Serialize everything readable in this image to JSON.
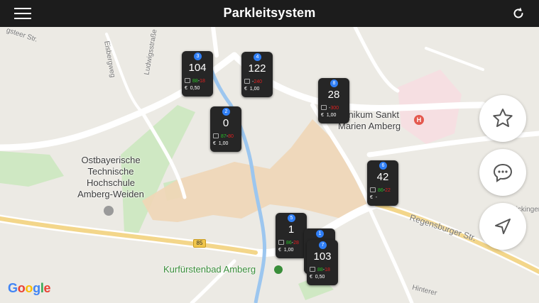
{
  "header": {
    "title": "Parkleitsystem",
    "menu_icon": "hamburger-menu-icon",
    "refresh_icon": "refresh-icon"
  },
  "map": {
    "places": {
      "university": "Ostbayerische\nTechnische\nHochschule\nAmberg-Weiden",
      "clinic": "Klinikum Sankt\nMarien Amberg",
      "pool": "Kurfürstenbad Amberg"
    },
    "streets": {
      "s1": "gsteer Str.",
      "s2": "Eisbergweg",
      "s3": "Ludwigsstraße",
      "s4": "Regensburger Str.",
      "s5": "Hinterer",
      "s6": "Sickingenring"
    },
    "road_badge": "85",
    "google_logo": [
      "G",
      "o",
      "o",
      "g",
      "l",
      "e"
    ]
  },
  "carparks": [
    {
      "id": "3",
      "free": "104",
      "green": "88",
      "red": "18",
      "price": "0,50"
    },
    {
      "id": "4",
      "free": "122",
      "green": "",
      "red": "240",
      "price": "1,00"
    },
    {
      "id": "8",
      "free": "28",
      "green": "",
      "red": "300",
      "price": "1,00"
    },
    {
      "id": "2",
      "free": "0",
      "green": "87",
      "red": "80",
      "price": "1,00"
    },
    {
      "id": "6",
      "free": "42",
      "green": "86",
      "red": "22",
      "price": "-"
    },
    {
      "id": "5",
      "free": "1",
      "green": "86",
      "red": "28",
      "price": "1,00"
    },
    {
      "id": "1",
      "free": "",
      "green": "",
      "red": "",
      "price": ""
    },
    {
      "id": "7",
      "free": "103",
      "green": "88",
      "red": "18",
      "price": "0,50"
    }
  ],
  "currency_symbol": "€",
  "fabs": {
    "favorites_icon": "star-icon",
    "messages_icon": "chat-bubble-icon",
    "locate_icon": "navigation-arrow-icon"
  },
  "colors": {
    "topbar": "#1c1c1c",
    "marker_badge": "#2f7ef5",
    "free_green": "#27c127",
    "occupied_red": "#e02020"
  }
}
